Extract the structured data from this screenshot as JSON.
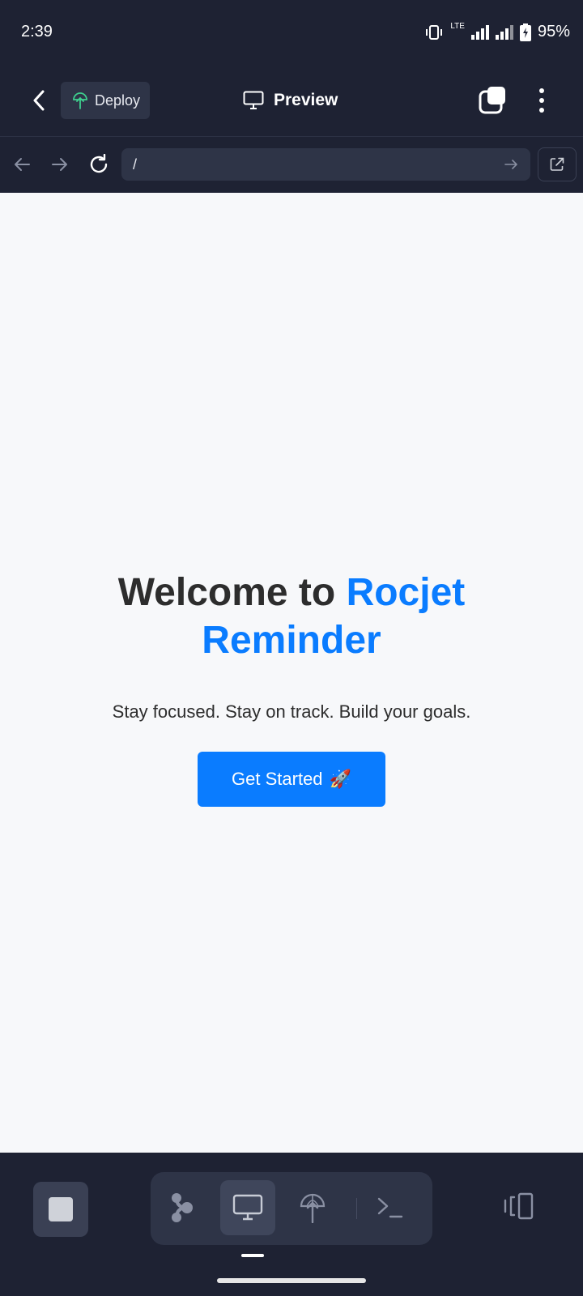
{
  "status_bar": {
    "time": "2:39",
    "network": "LTE",
    "battery": "95%"
  },
  "header": {
    "deploy_label": "Deploy",
    "title": "Preview"
  },
  "browser": {
    "url": "/"
  },
  "page": {
    "title_prefix": "Welcome to ",
    "title_brand": "Rocjet Reminder",
    "subtitle": "Stay focused. Stay on track. Build your goals.",
    "cta_label": "Get Started",
    "cta_emoji": "🚀"
  },
  "colors": {
    "accent": "#0a7cff",
    "chrome_bg": "#1e2233",
    "chip_bg": "#2e3447",
    "deploy_icon": "#3ecf8e"
  },
  "icons": [
    "back-icon",
    "deploy-icon",
    "monitor-icon",
    "tabs-icon",
    "more-icon",
    "nav-back-icon",
    "nav-forward-icon",
    "reload-icon",
    "go-arrow-icon",
    "external-link-icon",
    "stop-icon",
    "source-control-icon",
    "preview-icon",
    "deploy-tool-icon",
    "terminal-icon",
    "device-toggle-icon"
  ]
}
